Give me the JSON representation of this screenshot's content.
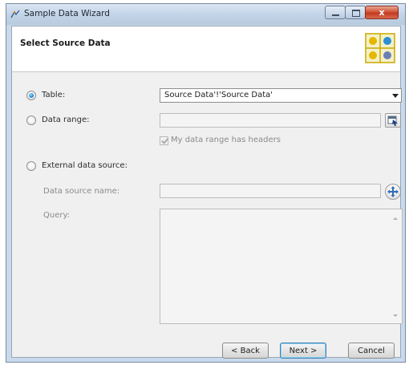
{
  "window": {
    "title": "Sample Data Wizard",
    "close_glyph": "x"
  },
  "header": {
    "title": "Select Source Data",
    "icon": "sample-data-grid-icon"
  },
  "source": {
    "table": {
      "label": "Table:",
      "selected": true,
      "value": "Source Data'!'Source Data'"
    },
    "data_range": {
      "label": "Data range:",
      "selected": false,
      "value": "",
      "picker_icon": "range-select-icon",
      "headers_checkbox_label": "My data range has headers",
      "headers_checked": true
    },
    "external": {
      "label": "External data source:",
      "selected": false,
      "data_source_name_label": "Data source name:",
      "data_source_name_value": "",
      "browse_icon": "browse-data-source-icon",
      "query_label": "Query:",
      "query_value": ""
    }
  },
  "buttons": {
    "back": "< Back",
    "next": "Next >",
    "cancel": "Cancel"
  },
  "colors": {
    "title_bar": "#c3d4e8",
    "dialog_bg": "#f0f0f0",
    "close_button": "#c23a20",
    "radio_selected": "#1e78c8"
  }
}
